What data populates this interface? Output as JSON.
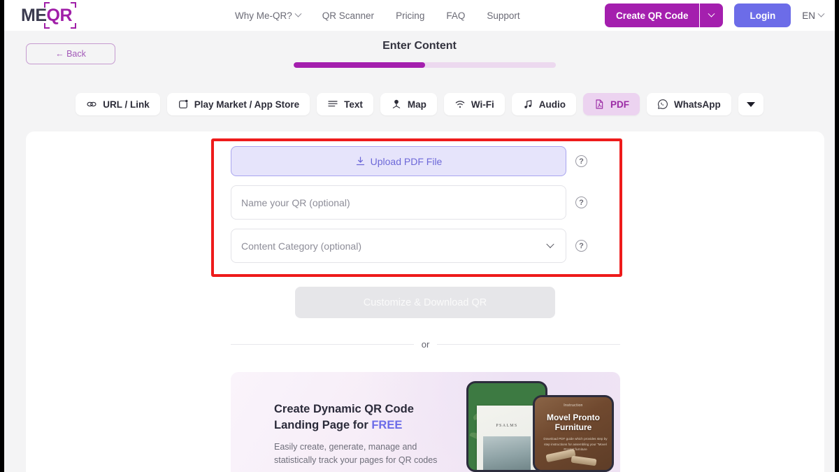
{
  "header": {
    "logo": {
      "part1": "ME",
      "part2": "QR",
      "icon": "qr-bracket-icon"
    },
    "nav": [
      {
        "label": "Why Me-QR?",
        "has_caret": true
      },
      {
        "label": "QR Scanner",
        "has_caret": false
      },
      {
        "label": "Pricing",
        "has_caret": false
      },
      {
        "label": "FAQ",
        "has_caret": false
      },
      {
        "label": "Support",
        "has_caret": false
      }
    ],
    "create_button": "Create QR Code",
    "create_caret_icon": "chevron-down-icon",
    "login_button": "Login",
    "language": "EN",
    "language_caret_icon": "chevron-down-icon"
  },
  "subheader": {
    "back_label": "← Back",
    "step_title": "Enter Content",
    "progress_percent": 50
  },
  "tabs": [
    {
      "label": "URL / Link",
      "icon": "link-icon",
      "active": false
    },
    {
      "label": "Play Market / App Store",
      "icon": "app-store-icon",
      "active": false
    },
    {
      "label": "Text",
      "icon": "text-lines-icon",
      "active": false
    },
    {
      "label": "Map",
      "icon": "map-pin-icon",
      "active": false
    },
    {
      "label": "Wi-Fi",
      "icon": "wifi-icon",
      "active": false
    },
    {
      "label": "Audio",
      "icon": "music-note-icon",
      "active": false
    },
    {
      "label": "PDF",
      "icon": "pdf-file-icon",
      "active": true
    },
    {
      "label": "WhatsApp",
      "icon": "whatsapp-icon",
      "active": false
    }
  ],
  "tabs_more_icon": "triangle-down-icon",
  "form": {
    "upload": {
      "label": "Upload PDF File",
      "icon": "download-upload-icon"
    },
    "name_placeholder": "Name your QR (optional)",
    "name_value": "",
    "category_placeholder": "Content Category (optional)",
    "category_value": "",
    "category_caret_icon": "chevron-down-icon",
    "help_icon": "?",
    "help_icon_name": "question-mark-icon",
    "submit_label": "Customize & Download QR",
    "submit_disabled": true
  },
  "divider": {
    "label": "or"
  },
  "promo": {
    "heading_line1": "Create Dynamic QR Code",
    "heading_line2_pre": "Landing Page for ",
    "heading_line2_accent": "FREE",
    "subtext_line1": "Easily create, generate, manage and",
    "subtext_line2": "statistically track your pages for QR codes",
    "phone_left": {
      "book_title": "PSALMS"
    },
    "phone_right": {
      "eyebrow": "Instruction",
      "title_line1": "Movel Pronto",
      "title_line2": "Furniture",
      "desc": "Download PDF guide which provides step by step instructions for assembling your \"Movel Pronto\" furniture"
    }
  },
  "colors": {
    "brand_purple": "#a41fae",
    "login_indigo": "#6c6ce8",
    "active_tab_bg": "#ecd3f0",
    "active_tab_text": "#9b2ba5",
    "upload_bg": "#e6e4fb",
    "upload_border": "#a9a5ef",
    "upload_text": "#6d68d8",
    "progress_track": "#ecd9ef",
    "highlight_red": "#ee1b1b",
    "page_bg": "#f4f4f5",
    "disabled_button": "#e6e6e9"
  }
}
